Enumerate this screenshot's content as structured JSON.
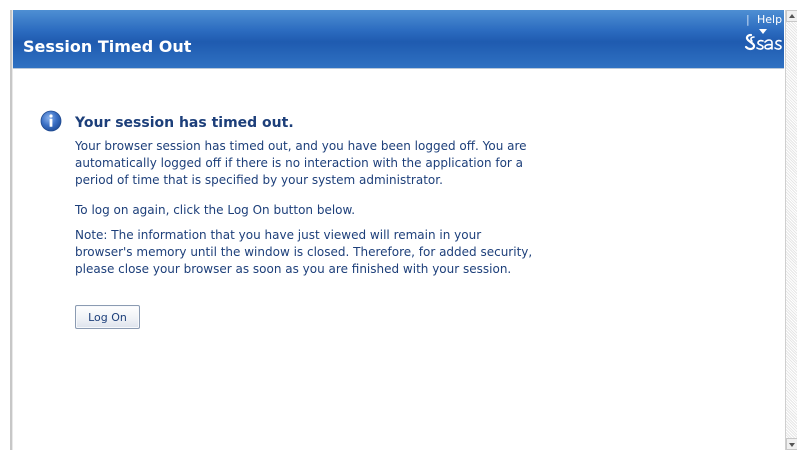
{
  "header": {
    "title": "Session Timed Out",
    "help_divider": "|",
    "help_label": "Help",
    "logo_icon": "sas-logo-icon"
  },
  "message": {
    "heading": "Your session has timed out.",
    "paragraph1": "Your browser session has timed out, and you have been logged off. You are automatically logged off if there is no interaction with the application for a period of time that is specified by your system administrator.",
    "paragraph2": "To log on again, click the Log On button below.",
    "paragraph3": "Note: The information that you have just viewed will remain in your browser's memory until the window is closed. Therefore, for added security, please close your browser as soon as you are finished with your session.",
    "icon": "info-icon"
  },
  "actions": {
    "logon_label": "Log On"
  },
  "colors": {
    "banner": "#2c6cc0",
    "text": "#1d3f7a",
    "icon": "#3a6fc4"
  }
}
